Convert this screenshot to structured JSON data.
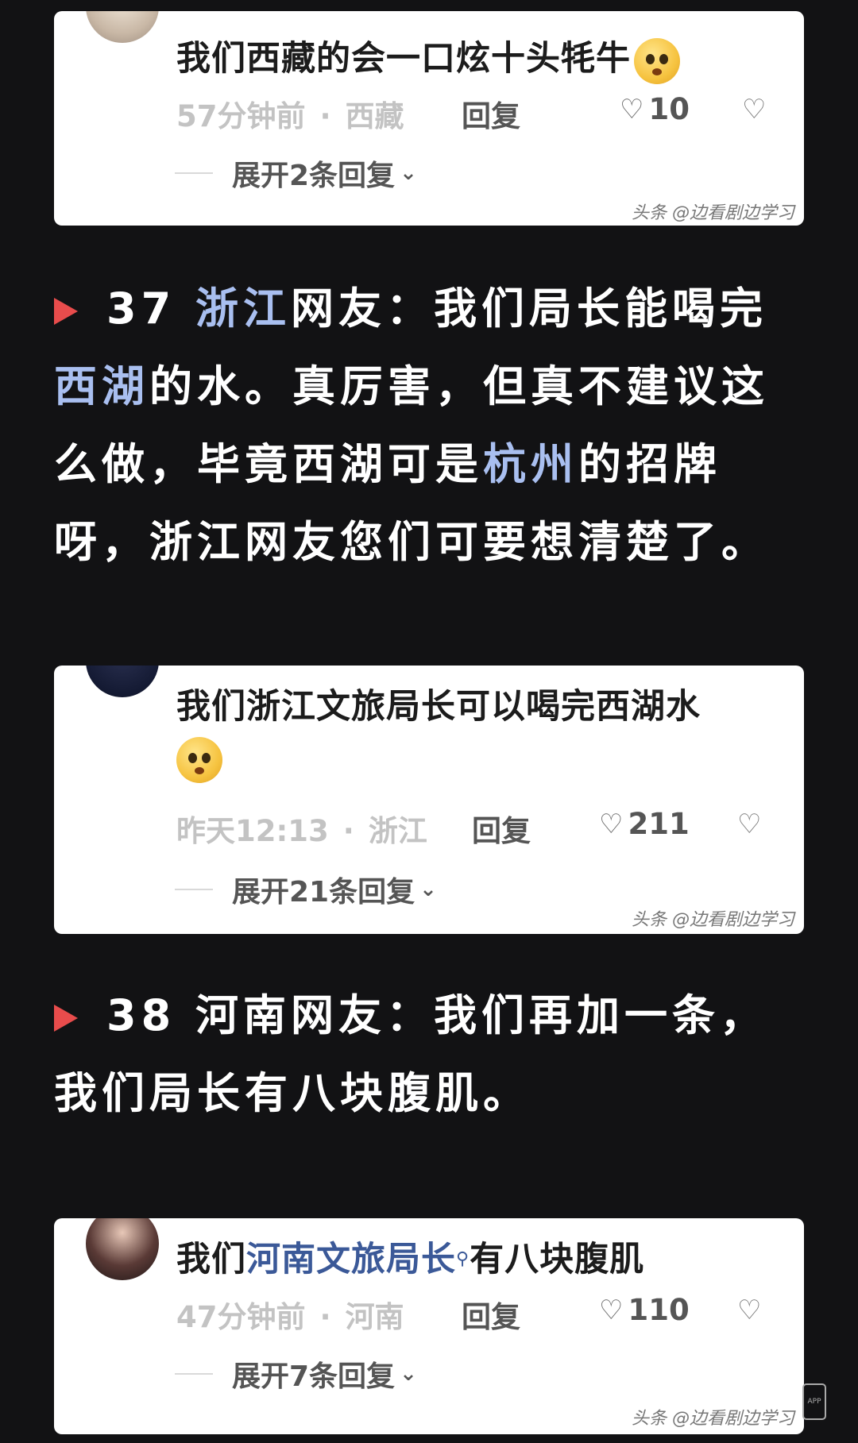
{
  "card1": {
    "text": "我们西藏的会一口炫十头牦牛",
    "time": "57分钟前",
    "sep": "·",
    "location": "西藏",
    "reply": "回复",
    "likes": "10",
    "expand": "展开2条回复",
    "watermark": "头条 @边看剧边学习"
  },
  "story1": {
    "number": "37",
    "prov": "浙江",
    "t1": "网友：我们局长能喝完",
    "hl1": "西湖",
    "t2": "的水。真厉害，但真不建议这么做，毕竟西湖可是",
    "hl2": "杭州",
    "t3": "的招牌呀，浙江网友您们可要想清楚了。"
  },
  "card2": {
    "text": "我们浙江文旅局长可以喝完西湖水",
    "time": "昨天12:13",
    "sep": "·",
    "location": "浙江",
    "reply": "回复",
    "likes": "211",
    "expand": "展开21条回复",
    "watermark": "头条 @边看剧边学习"
  },
  "story2": {
    "number": "38",
    "t1": "河南网友：我们再加一条，我们局长有八块腹肌。"
  },
  "card3": {
    "text_prefix": "我们",
    "text_link": "河南文旅局长",
    "text_suffix": "有八块腹肌",
    "time": "47分钟前",
    "sep": "·",
    "location": "河南",
    "reply": "回复",
    "likes": "110",
    "expand": "展开7条回复",
    "watermark": "头条 @边看剧边学习"
  },
  "app_badge": "APP"
}
